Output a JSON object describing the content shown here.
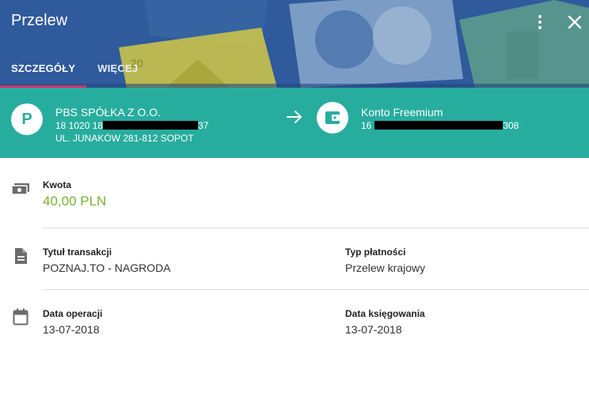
{
  "header": {
    "title": "Przelew",
    "tabs": [
      "SZCZEGÓŁY",
      "WIĘCEJ"
    ],
    "active_tab": "SZCZEGÓŁY",
    "accent_color": "#d62f73",
    "background_color": "#2f5a9c"
  },
  "icons": {
    "menu": "more-vertical-icon",
    "close": "close-icon",
    "transfer": "arrow-right-icon",
    "amount": "money-icon",
    "title": "document-icon",
    "date": "calendar-icon",
    "receiver": "wallet-icon"
  },
  "transfer": {
    "band_color": "#27ad9e",
    "sender": {
      "initial": "P",
      "name": "PBS SPÓŁKA Z O.O.",
      "account_prefix": "18 1020 18",
      "account_suffix": "37",
      "address": "UL. JUNAKÓW 281-812 SOPOT"
    },
    "receiver": {
      "name": "Konto Freemium",
      "account_prefix": "16",
      "account_suffix": "308"
    }
  },
  "details": {
    "amount_label": "Kwota",
    "amount_value": "40,00 PLN",
    "amount_color": "#79b232",
    "title_label": "Tytuł transakcji",
    "title_value": "POZNAJ.TO - NAGRODA",
    "type_label": "Typ płatności",
    "type_value": "Przelew krajowy",
    "op_date_label": "Data operacji",
    "op_date_value": "13-07-2018",
    "booking_date_label": "Data księgowania",
    "booking_date_value": "13-07-2018"
  }
}
